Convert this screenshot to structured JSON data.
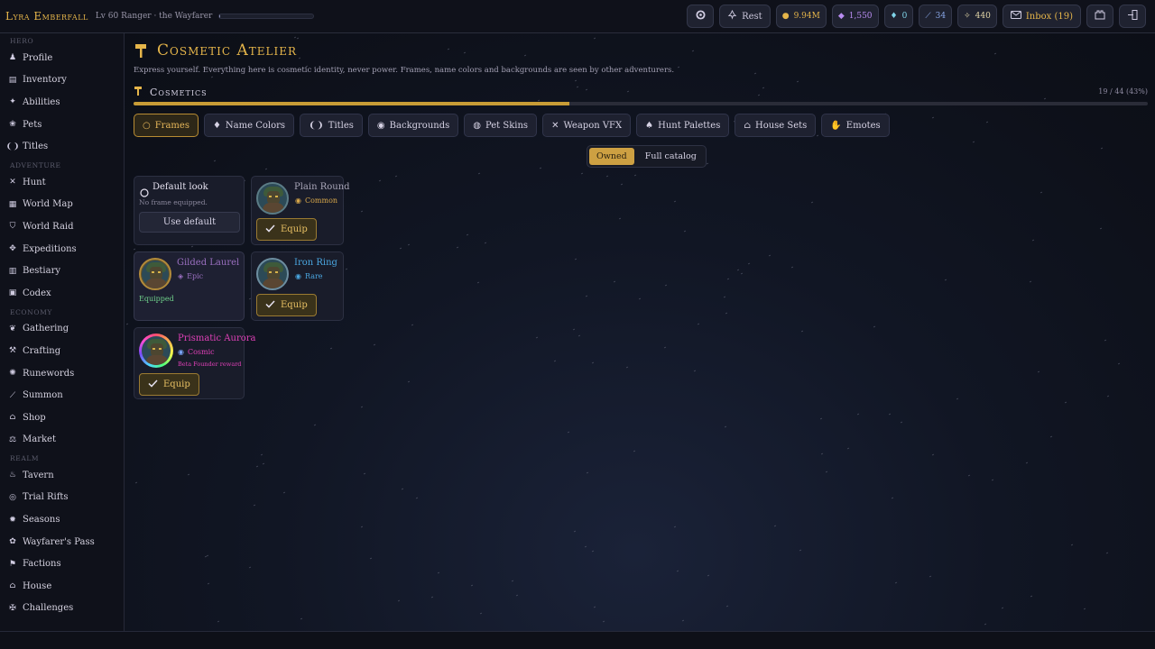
{
  "header": {
    "hero_name": "Lyra Emberfall",
    "hero_subtitle": "Lv 60 Ranger · the Wayfarer",
    "xp_fraction": 0.01,
    "buttons": {
      "rest": "Rest",
      "gold": "9.94M",
      "gems": "1,550",
      "shards": "0",
      "feathers": "34",
      "dust": "440",
      "inbox": "Inbox (19)"
    }
  },
  "sidebar": {
    "sections": [
      {
        "title": "HERO",
        "items": [
          {
            "label": "Profile",
            "icon": "person-icon"
          },
          {
            "label": "Inventory",
            "icon": "backpack-icon"
          },
          {
            "label": "Abilities",
            "icon": "sparkle-icon"
          },
          {
            "label": "Pets",
            "icon": "paw-icon"
          },
          {
            "label": "Titles",
            "icon": "laurel-icon"
          }
        ]
      },
      {
        "title": "ADVENTURE",
        "items": [
          {
            "label": "Hunt",
            "icon": "crossed-swords-icon"
          },
          {
            "label": "World Map",
            "icon": "map-icon"
          },
          {
            "label": "World Raid",
            "icon": "raid-icon"
          },
          {
            "label": "Expeditions",
            "icon": "compass-icon"
          },
          {
            "label": "Bestiary",
            "icon": "book-icon"
          },
          {
            "label": "Codex",
            "icon": "scroll-icon"
          }
        ]
      },
      {
        "title": "ECONOMY",
        "items": [
          {
            "label": "Gathering",
            "icon": "leaf-icon"
          },
          {
            "label": "Crafting",
            "icon": "hammer-icon"
          },
          {
            "label": "Runewords",
            "icon": "rune-icon"
          },
          {
            "label": "Summon",
            "icon": "wand-icon"
          },
          {
            "label": "Shop",
            "icon": "shop-icon"
          },
          {
            "label": "Market",
            "icon": "scales-icon"
          }
        ]
      },
      {
        "title": "REALM",
        "items": [
          {
            "label": "Tavern",
            "icon": "mug-icon"
          },
          {
            "label": "Trial Rifts",
            "icon": "rift-icon"
          },
          {
            "label": "Seasons",
            "icon": "sun-icon"
          },
          {
            "label": "Wayfarer's Pass",
            "icon": "ticket-icon"
          },
          {
            "label": "Factions",
            "icon": "banner-icon"
          },
          {
            "label": "House",
            "icon": "house-icon"
          },
          {
            "label": "Challenges",
            "icon": "trophy-icon"
          }
        ]
      }
    ]
  },
  "page": {
    "title": "Cosmetic Atelier",
    "subtitle": "Express yourself. Everything here is cosmetic identity, never power. Frames, name colors and backgrounds are seen by other adventurers.",
    "section_title": "Cosmetics",
    "owned_count": "19 / 44 (43%)",
    "owned_fraction": 0.43,
    "tabs": [
      {
        "label": "Frames",
        "icon": "circle-outline-icon",
        "active": true
      },
      {
        "label": "Name Colors",
        "icon": "droplet-icon"
      },
      {
        "label": "Titles",
        "icon": "laurel-icon"
      },
      {
        "label": "Backgrounds",
        "icon": "target-icon"
      },
      {
        "label": "Pet Skins",
        "icon": "paw-circle-icon"
      },
      {
        "label": "Weapon VFX",
        "icon": "crossed-swords-icon"
      },
      {
        "label": "Hunt Palettes",
        "icon": "flame-icon"
      },
      {
        "label": "House Sets",
        "icon": "house-icon"
      },
      {
        "label": "Emotes",
        "icon": "hand-icon"
      }
    ],
    "view_toggle": {
      "owned": "Owned",
      "catalog": "Full catalog"
    },
    "cards": {
      "default": {
        "title": "Default look",
        "note": "No frame equipped.",
        "button": "Use default"
      },
      "plain_round": {
        "name": "Plain Round",
        "rarity": "Common",
        "button": "Equip"
      },
      "gilded_laurel": {
        "name": "Gilded Laurel",
        "rarity": "Epic",
        "status": "Equipped"
      },
      "iron_ring": {
        "name": "Iron Ring",
        "rarity": "Rare",
        "button": "Equip"
      },
      "prismatic_aurora": {
        "name": "Prismatic Aurora",
        "rarity": "Cosmic",
        "source": "Beta Founder reward",
        "button": "Equip"
      }
    }
  },
  "colors": {
    "accent_gold": "#e5b54a",
    "common": "#d9a84a",
    "epic": "#b07fd8",
    "rare": "#4aa6e0",
    "cosmic": "#e040b8",
    "equipped_text": "#6fcf8a"
  }
}
